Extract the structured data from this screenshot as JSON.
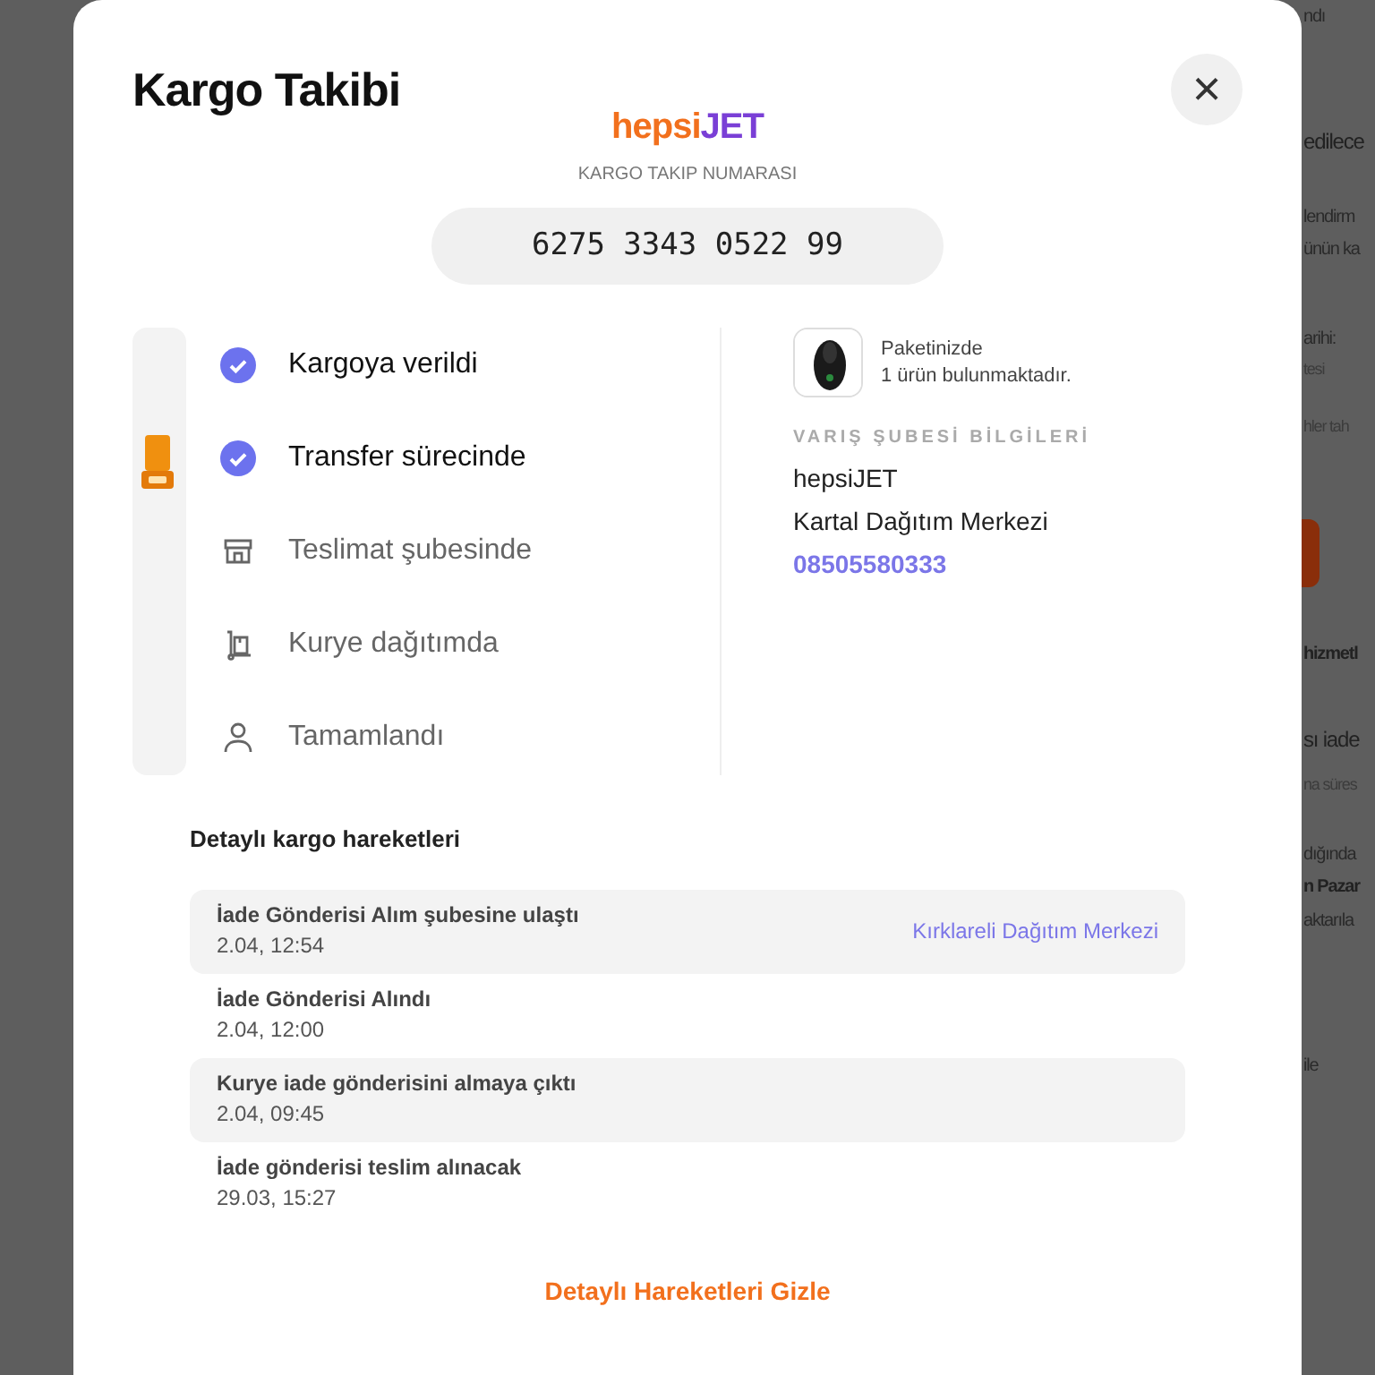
{
  "background_page": {
    "fragments": [
      {
        "text": "ndı",
        "kind": "text"
      },
      {
        "text": "edilece",
        "kind": "heading"
      },
      {
        "text": "lendirm",
        "kind": "text"
      },
      {
        "text": "ünün ka",
        "kind": "text"
      },
      {
        "text": "arihi:",
        "kind": "text"
      },
      {
        "text": "tesi",
        "kind": "muted"
      },
      {
        "text": "hler tah",
        "kind": "muted"
      },
      {
        "kind": "button"
      },
      {
        "text": "hizmetl",
        "kind": "bold"
      },
      {
        "text": "sı iade",
        "kind": "heading"
      },
      {
        "text": "na süres",
        "kind": "muted"
      },
      {
        "text": "dığında",
        "kind": "text"
      },
      {
        "text": "n Pazar",
        "kind": "bold"
      },
      {
        "text": "aktarıla",
        "kind": "text"
      },
      {
        "text": "ile",
        "kind": "text"
      }
    ]
  },
  "modal": {
    "title": "Kargo Takibi",
    "close": "×",
    "carrier": {
      "logo": [
        "hepsi",
        "JET"
      ],
      "caption": "KARGO TAKIP NUMARASI",
      "tracking_number": "6275 3343 0522 99"
    },
    "steps": [
      {
        "label": "Kargoya verildi",
        "done": true,
        "current": false
      },
      {
        "label": "Transfer sürecinde",
        "done": true,
        "current": true
      },
      {
        "label": "Teslimat şubesinde",
        "done": false,
        "current": false,
        "kind": "store"
      },
      {
        "label": "Kurye dağıtımda",
        "done": false,
        "current": false,
        "kind": "courier"
      },
      {
        "label": "Tamamlandı",
        "done": false,
        "current": false,
        "kind": "person"
      }
    ],
    "package": {
      "line1": "Paketinizde",
      "line2": "1 ürün bulunmaktadır."
    },
    "branch": {
      "heading": "VARIŞ ŞUBESİ BİLGİLERİ",
      "company": "hepsiJET",
      "name": "Kartal Dağıtım Merkezi",
      "phone": "08505580333"
    },
    "history": {
      "heading": "Detaylı kargo hareketleri",
      "rows": [
        {
          "event": "İade Gönderisi Alım şubesine ulaştı",
          "time": "2.04, 12:54",
          "location": "Kırklareli Dağıtım Merkezi"
        },
        {
          "event": "İade Gönderisi Alındı",
          "time": "2.04, 12:00"
        },
        {
          "event": "Kurye iade gönderisini almaya çıktı",
          "time": "2.04, 09:45"
        },
        {
          "event": "İade gönderisi teslim alınacak",
          "time": "29.03, 15:27"
        }
      ],
      "toggle": "Detaylı Hareketleri Gizle"
    }
  }
}
